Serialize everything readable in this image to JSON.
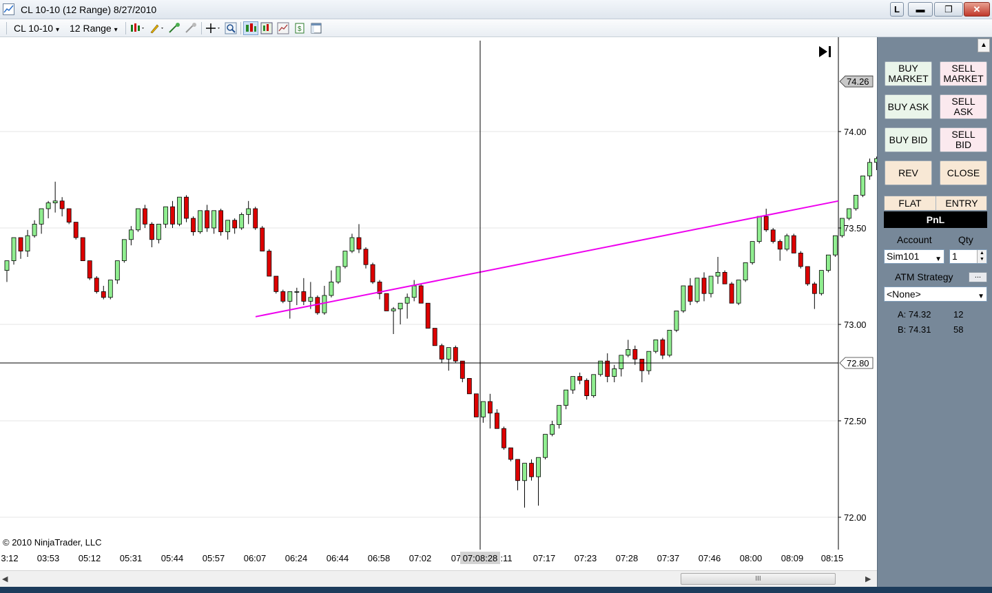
{
  "window": {
    "title": "CL 10-10 (12 Range)  8/27/2010",
    "buttons": {
      "l": "L",
      "minimize": "▬",
      "maximize": "❐",
      "close": "✕"
    }
  },
  "toolbar": {
    "instrument": "CL 10-10",
    "interval": "12 Range",
    "dropdown_glyph": "▾",
    "icons": [
      "chart-style-icon",
      "draw-pencil-icon",
      "add-indicator-icon",
      "remove-indicator-icon",
      "crosshair-icon",
      "zoom-icon",
      "chart-trader-icon",
      "data-box-icon",
      "strategies-icon",
      "properties-icon",
      "window-icon"
    ]
  },
  "chart": {
    "copyright": "© 2010 NinjaTrader, LLC",
    "price_labels": [
      "74.00",
      "73.50",
      "73.00",
      "72.50",
      "72.00"
    ],
    "last_price": "74.26",
    "crosshair_price": "72.80",
    "crosshair_time": "07:08:28",
    "time_labels": [
      "3:12",
      "03:53",
      "05:12",
      "05:31",
      "05:44",
      "05:57",
      "06:07",
      "06:24",
      "06:44",
      "06:58",
      "07:02",
      "07",
      ":11",
      "07:17",
      "07:23",
      "07:28",
      "07:37",
      "07:46",
      "08:00",
      "08:09",
      "08:15"
    ],
    "colors": {
      "up": "#90ee90",
      "down": "#dd0000",
      "trendline": "#ee00ee",
      "grid": "#e6e6e6"
    }
  },
  "chart_data": {
    "type": "candlestick",
    "title": "CL 10-10 (12 Range)  8/27/2010",
    "ylim": [
      71.88,
      74.38
    ],
    "candles": [
      [
        73.28,
        73.33,
        73.22,
        73.33
      ],
      [
        73.33,
        73.45,
        73.31,
        73.45
      ],
      [
        73.45,
        73.38,
        73.34,
        73.45
      ],
      [
        73.38,
        73.46,
        73.35,
        73.49
      ],
      [
        73.46,
        73.52,
        73.45,
        73.54
      ],
      [
        73.52,
        73.6,
        73.47,
        73.6
      ],
      [
        73.6,
        73.63,
        73.55,
        73.64
      ],
      [
        73.63,
        73.64,
        73.58,
        73.74
      ],
      [
        73.64,
        73.6,
        73.56,
        73.66
      ],
      [
        73.6,
        73.53,
        73.52,
        73.6
      ],
      [
        73.53,
        73.45,
        73.44,
        73.53
      ],
      [
        73.45,
        73.33,
        73.33,
        73.45
      ],
      [
        73.33,
        73.24,
        73.23,
        73.33
      ],
      [
        73.24,
        73.17,
        73.16,
        73.25
      ],
      [
        73.17,
        73.14,
        73.13,
        73.2
      ],
      [
        73.14,
        73.23,
        73.13,
        73.23
      ],
      [
        73.23,
        73.33,
        73.21,
        73.33
      ],
      [
        73.33,
        73.44,
        73.32,
        73.44
      ],
      [
        73.44,
        73.49,
        73.41,
        73.51
      ],
      [
        73.49,
        73.6,
        73.48,
        73.6
      ],
      [
        73.6,
        73.52,
        73.5,
        73.62
      ],
      [
        73.52,
        73.44,
        73.4,
        73.53
      ],
      [
        73.44,
        73.52,
        73.42,
        73.52
      ],
      [
        73.52,
        73.61,
        73.5,
        73.61
      ],
      [
        73.61,
        73.52,
        73.5,
        73.64
      ],
      [
        73.52,
        73.66,
        73.51,
        73.66
      ],
      [
        73.66,
        73.55,
        73.53,
        73.67
      ],
      [
        73.55,
        73.48,
        73.46,
        73.56
      ],
      [
        73.48,
        73.59,
        73.47,
        73.59
      ],
      [
        73.59,
        73.5,
        73.48,
        73.62
      ],
      [
        73.5,
        73.59,
        73.47,
        73.59
      ],
      [
        73.59,
        73.48,
        73.46,
        73.6
      ],
      [
        73.48,
        73.54,
        73.44,
        73.54
      ],
      [
        73.54,
        73.5,
        73.47,
        73.55
      ],
      [
        73.5,
        73.57,
        73.49,
        73.58
      ],
      [
        73.57,
        73.6,
        73.52,
        73.64
      ],
      [
        73.6,
        73.5,
        73.49,
        73.61
      ],
      [
        73.5,
        73.38,
        73.38,
        73.51
      ],
      [
        73.38,
        73.25,
        73.25,
        73.39
      ],
      [
        73.25,
        73.17,
        73.16,
        73.25
      ],
      [
        73.17,
        73.12,
        73.11,
        73.18
      ],
      [
        73.12,
        73.17,
        73.03,
        73.17
      ],
      [
        73.17,
        73.17,
        73.1,
        73.19
      ],
      [
        73.17,
        73.12,
        73.1,
        73.24
      ],
      [
        73.12,
        73.14,
        73.08,
        73.22
      ],
      [
        73.14,
        73.06,
        73.05,
        73.15
      ],
      [
        73.06,
        73.15,
        73.05,
        73.2
      ],
      [
        73.15,
        73.22,
        73.14,
        73.28
      ],
      [
        73.22,
        73.3,
        73.21,
        73.3
      ],
      [
        73.3,
        73.38,
        73.29,
        73.38
      ],
      [
        73.38,
        73.45,
        73.37,
        73.47
      ],
      [
        73.45,
        73.39,
        73.37,
        73.52
      ],
      [
        73.39,
        73.31,
        73.29,
        73.4
      ],
      [
        73.31,
        73.22,
        73.21,
        73.32
      ],
      [
        73.22,
        73.16,
        73.13,
        73.23
      ],
      [
        73.16,
        73.07,
        73.07,
        73.16
      ],
      [
        73.07,
        73.08,
        72.95,
        73.09
      ],
      [
        73.08,
        73.11,
        73.0,
        73.11
      ],
      [
        73.11,
        73.14,
        73.03,
        73.16
      ],
      [
        73.14,
        73.2,
        73.12,
        73.23
      ],
      [
        73.2,
        73.11,
        73.11,
        73.21
      ],
      [
        73.11,
        72.98,
        72.98,
        73.11
      ],
      [
        72.98,
        72.89,
        72.89,
        72.98
      ],
      [
        72.89,
        72.82,
        72.8,
        72.9
      ],
      [
        72.82,
        72.88,
        72.76,
        72.88
      ],
      [
        72.88,
        72.81,
        72.8,
        72.89
      ],
      [
        72.81,
        72.72,
        72.7,
        72.81
      ],
      [
        72.72,
        72.64,
        72.64,
        72.72
      ],
      [
        72.64,
        72.52,
        72.52,
        72.64
      ],
      [
        72.52,
        72.6,
        72.49,
        72.6
      ],
      [
        72.6,
        72.54,
        72.46,
        72.64
      ],
      [
        72.54,
        72.46,
        72.46,
        72.56
      ],
      [
        72.46,
        72.36,
        72.35,
        72.47
      ],
      [
        72.36,
        72.3,
        72.29,
        72.36
      ],
      [
        72.3,
        72.19,
        72.14,
        72.3
      ],
      [
        72.19,
        72.28,
        72.05,
        72.28
      ],
      [
        72.28,
        72.21,
        72.19,
        72.3
      ],
      [
        72.21,
        72.31,
        72.06,
        72.31
      ],
      [
        72.31,
        72.43,
        72.3,
        72.43
      ],
      [
        72.43,
        72.48,
        72.42,
        72.5
      ],
      [
        72.48,
        72.58,
        72.46,
        72.58
      ],
      [
        72.58,
        72.66,
        72.56,
        72.66
      ],
      [
        72.66,
        72.73,
        72.64,
        72.73
      ],
      [
        72.73,
        72.71,
        72.69,
        72.75
      ],
      [
        72.71,
        72.63,
        72.61,
        72.72
      ],
      [
        72.63,
        72.74,
        72.62,
        72.74
      ],
      [
        72.74,
        72.81,
        72.73,
        72.81
      ],
      [
        72.81,
        72.73,
        72.7,
        72.85
      ],
      [
        72.73,
        72.77,
        72.7,
        72.79
      ],
      [
        72.77,
        72.84,
        72.73,
        72.84
      ],
      [
        72.84,
        72.87,
        72.83,
        72.92
      ],
      [
        72.87,
        72.82,
        72.79,
        72.89
      ],
      [
        72.82,
        72.76,
        72.7,
        72.82
      ],
      [
        72.76,
        72.86,
        72.74,
        72.86
      ],
      [
        72.86,
        72.92,
        72.85,
        72.92
      ],
      [
        72.92,
        72.84,
        72.82,
        72.93
      ],
      [
        72.84,
        72.97,
        72.83,
        72.97
      ],
      [
        72.97,
        73.07,
        72.96,
        73.07
      ],
      [
        73.07,
        73.2,
        73.06,
        73.2
      ],
      [
        73.2,
        73.12,
        73.1,
        73.24
      ],
      [
        73.12,
        73.24,
        73.11,
        73.24
      ],
      [
        73.24,
        73.16,
        73.12,
        73.27
      ],
      [
        73.16,
        73.25,
        73.14,
        73.25
      ],
      [
        73.25,
        73.27,
        73.21,
        73.35
      ],
      [
        73.27,
        73.21,
        73.21,
        73.28
      ],
      [
        73.21,
        73.11,
        73.11,
        73.22
      ],
      [
        73.11,
        73.23,
        73.1,
        73.23
      ],
      [
        73.23,
        73.32,
        73.22,
        73.32
      ],
      [
        73.32,
        73.43,
        73.31,
        73.43
      ],
      [
        73.43,
        73.56,
        73.42,
        73.56
      ],
      [
        73.56,
        73.49,
        73.48,
        73.6
      ],
      [
        73.49,
        73.43,
        73.42,
        73.5
      ],
      [
        73.43,
        73.39,
        73.33,
        73.44
      ],
      [
        73.39,
        73.46,
        73.38,
        73.47
      ],
      [
        73.46,
        73.37,
        73.37,
        73.47
      ],
      [
        73.37,
        73.3,
        73.29,
        73.38
      ],
      [
        73.3,
        73.21,
        73.2,
        73.3
      ],
      [
        73.21,
        73.16,
        73.08,
        73.22
      ],
      [
        73.16,
        73.28,
        73.15,
        73.28
      ],
      [
        73.28,
        73.36,
        73.27,
        73.36
      ],
      [
        73.36,
        73.46,
        73.35,
        73.46
      ],
      [
        73.46,
        73.55,
        73.45,
        73.55
      ],
      [
        73.55,
        73.6,
        73.54,
        73.6
      ],
      [
        73.6,
        73.67,
        73.59,
        73.67
      ],
      [
        73.67,
        73.77,
        73.66,
        73.77
      ],
      [
        73.77,
        73.84,
        73.75,
        73.86
      ],
      [
        73.84,
        73.86,
        73.8,
        73.87
      ],
      [
        73.86,
        73.83,
        73.82,
        73.89
      ],
      [
        73.83,
        73.95,
        73.82,
        73.95
      ],
      [
        73.95,
        74.04,
        73.94,
        74.04
      ],
      [
        74.04,
        74.16,
        74.03,
        74.16
      ],
      [
        74.16,
        74.26,
        74.14,
        74.26
      ]
    ],
    "trendline": {
      "start": 73.04,
      "end": 73.64
    }
  },
  "panel": {
    "buttons": {
      "buy_market": "BUY\nMARKET",
      "sell_market": "SELL\nMARKET",
      "buy_ask": "BUY ASK",
      "sell_ask": "SELL\nASK",
      "buy_bid": "BUY BID",
      "sell_bid": "SELL\nBID",
      "rev": "REV",
      "close": "CLOSE"
    },
    "flat": "FLAT",
    "entry": "ENTRY",
    "pnl": "PnL",
    "account_label": "Account",
    "qty_label": "Qty",
    "account_value": "Sim101",
    "qty_value": "1",
    "atm_label": "ATM Strategy",
    "atm_value": "<None>",
    "ask_label": "A: 74.32",
    "ask_size": "12",
    "bid_label": "B: 74.31",
    "bid_size": "58"
  },
  "scrollbar": {
    "left": "◀",
    "right": "▶",
    "thumb": "III"
  }
}
